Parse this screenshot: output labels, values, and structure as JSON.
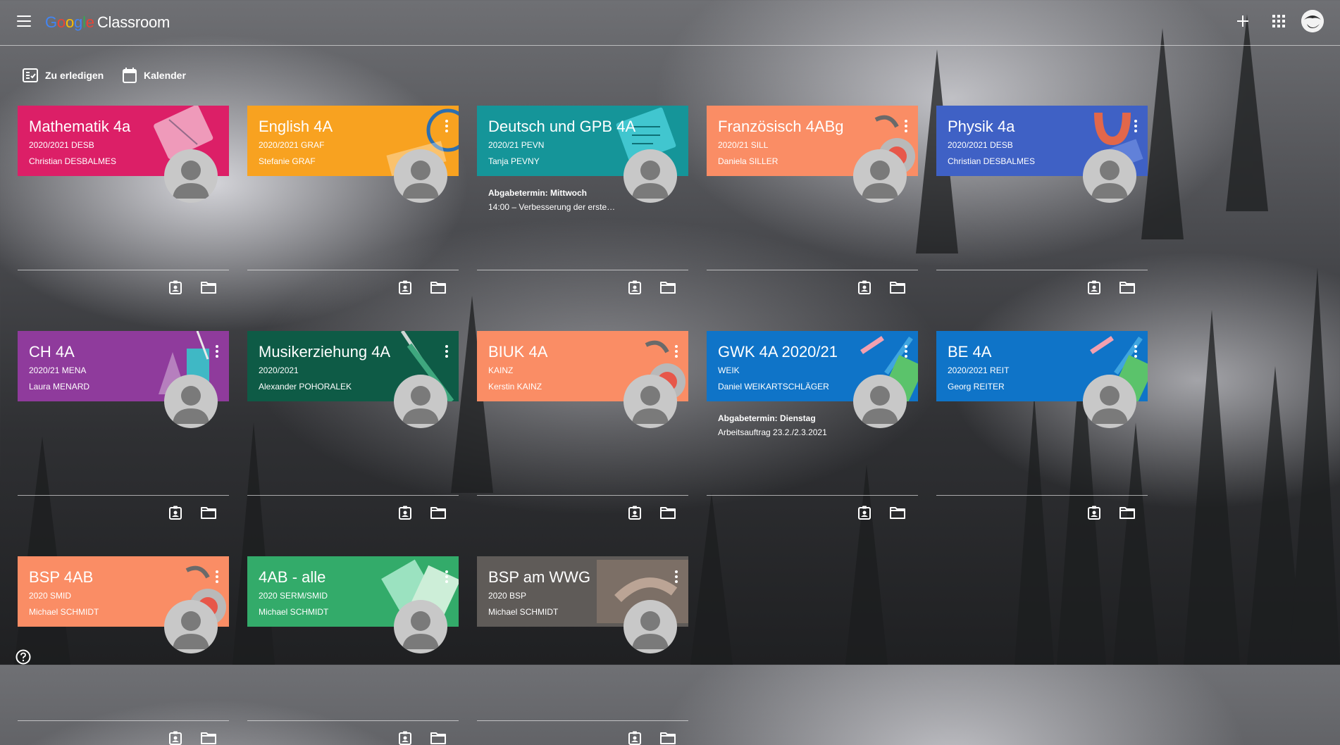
{
  "app": {
    "brand_google": [
      "G",
      "o",
      "o",
      "g",
      "l",
      "e"
    ],
    "brand_product": "Classroom"
  },
  "nav": {
    "todo_label": "Zu erledigen",
    "calendar_label": "Kalender"
  },
  "icons": {
    "menu": "hamburger-menu-icon",
    "add": "plus-icon",
    "apps": "apps-grid-icon",
    "todo": "checklist-icon",
    "calendar": "calendar-icon",
    "gradebook": "assignment-ind-icon",
    "folder": "folder-icon",
    "help": "help-icon"
  },
  "cards": [
    {
      "title": "Mathematik 4a",
      "section": "2020/2021 DESB",
      "teacher": "Christian DESBALMES",
      "color": "#dc1f67",
      "menu": false
    },
    {
      "title": "English 4A",
      "section": "2020/2021 GRAF",
      "teacher": "Stefanie GRAF",
      "color": "#f8a220",
      "menu": true
    },
    {
      "title": "Deutsch und GPB 4A",
      "section": "2020/21 PEVN",
      "teacher": "Tanja PEVNY",
      "color": "#159599",
      "menu": false,
      "due_label": "Abgabetermin: Mittwoch",
      "due_text": "14:00 – Verbesserung der erste…"
    },
    {
      "title": "Französisch 4ABg",
      "section": "2020/21 SILL",
      "teacher": "Daniela SILLER",
      "color": "#fa8d65",
      "menu": true
    },
    {
      "title": "Physik 4a",
      "section": "2020/2021 DESB",
      "teacher": "Christian DESBALMES",
      "color": "#3f61c5",
      "menu": true
    },
    {
      "title": "CH 4A",
      "section": "2020/21 MENA",
      "teacher": "Laura MENARD",
      "color": "#8f3b9c",
      "menu": true
    },
    {
      "title": "Musikerziehung 4A",
      "section": "2020/2021",
      "teacher": "Alexander POHORALEK",
      "color": "#0e5b46",
      "menu": true
    },
    {
      "title": "BIUK 4A",
      "section": "KAINZ",
      "teacher": "Kerstin KAINZ",
      "color": "#fa8d65",
      "menu": true
    },
    {
      "title": "GWK 4A 2020/21",
      "section": "WEIK",
      "teacher": "Daniel WEIKARTSCHLÄGER",
      "color": "#0f74c8",
      "menu": true,
      "due_label": "Abgabetermin: Dienstag",
      "due_text": "Arbeitsauftrag 23.2./2.3.2021"
    },
    {
      "title": "BE 4A",
      "section": "2020/2021 REIT",
      "teacher": "Georg REITER",
      "color": "#0f74c8",
      "menu": true
    },
    {
      "title": "BSP 4AB",
      "section": "2020 SMID",
      "teacher": "Michael SCHMIDT",
      "color": "#fa8d65",
      "menu": true
    },
    {
      "title": "4AB - alle",
      "section": "2020 SERM/SMID",
      "teacher": "Michael SCHMIDT",
      "color": "#33ab6a",
      "menu": true
    },
    {
      "title": "BSP am WWG",
      "section": "2020 BSP",
      "teacher": "Michael SCHMIDT",
      "color": "#5f5b58",
      "menu": true
    }
  ]
}
